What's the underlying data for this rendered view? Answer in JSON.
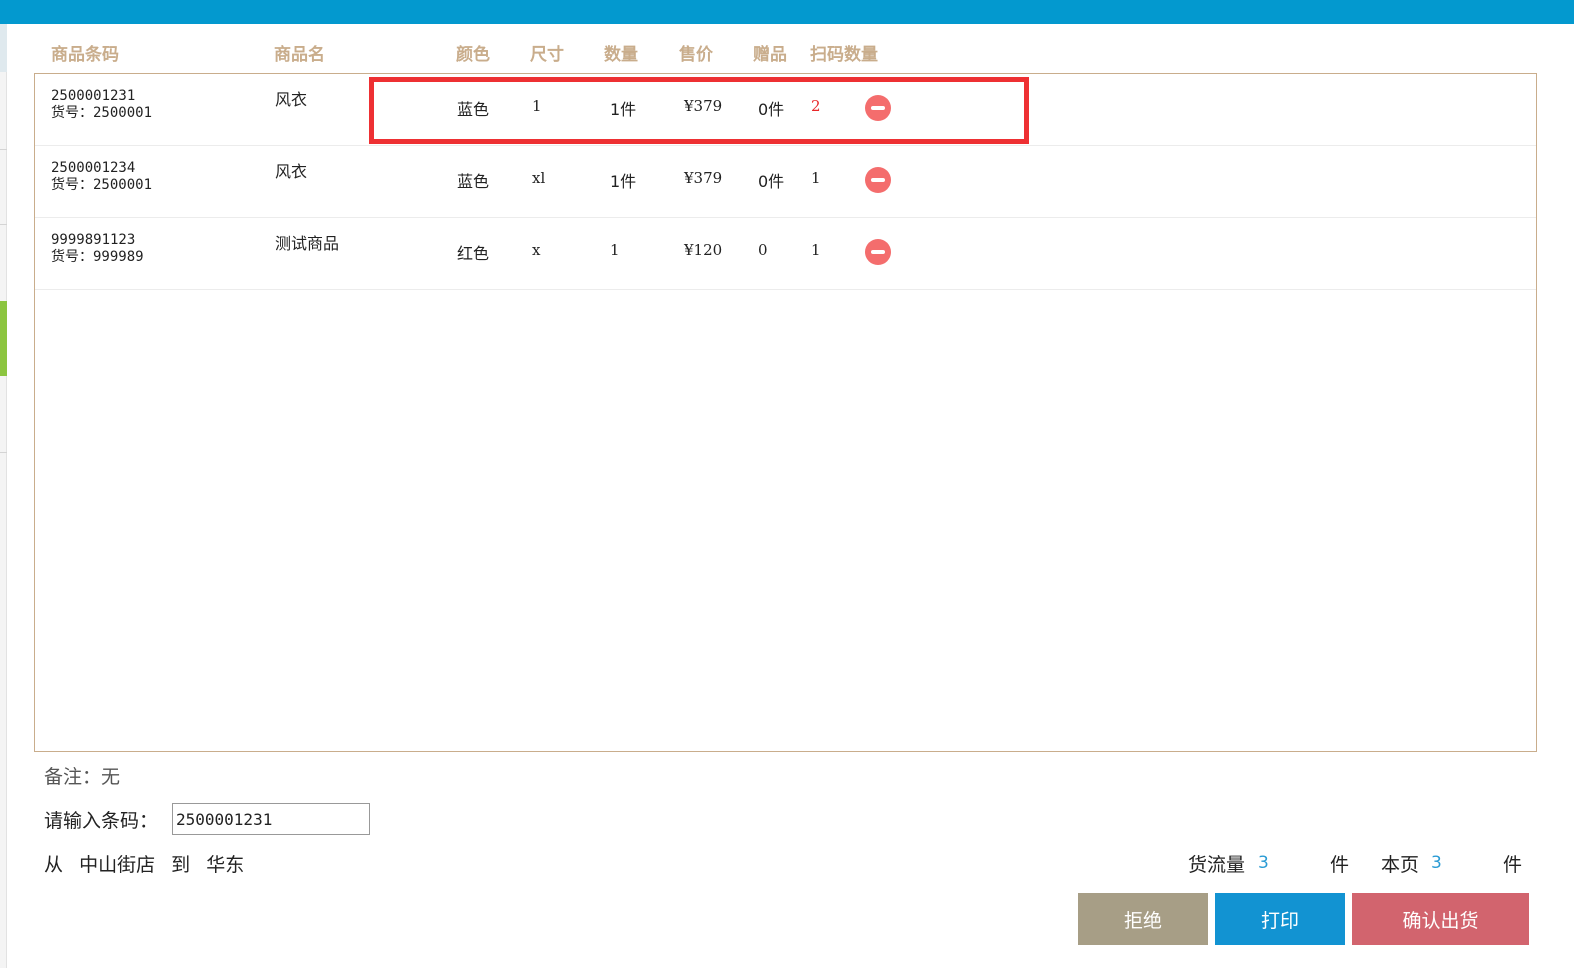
{
  "colors": {
    "topbar": "#0399cf",
    "header_text": "#c9ad8c",
    "highlight": "#ee3033",
    "scan_red": "#e8282a",
    "remove_icon": "#f46d6d",
    "stat_number": "#2a9bd4",
    "reject_button": "#a79e86",
    "print_button": "#1293d2",
    "confirm_button": "#d2646e"
  },
  "table": {
    "headers": {
      "barcode": "商品条码",
      "name": "商品名",
      "color": "颜色",
      "size": "尺寸",
      "qty": "数量",
      "price": "售价",
      "gift": "赠品",
      "scan_qty": "扫码数量"
    },
    "rows": [
      {
        "barcode": "2500001231",
        "sku": "货号：2500001",
        "name": "风衣",
        "color": "蓝色",
        "size": "1",
        "qty": "1件",
        "price": "¥379",
        "gift": "0件",
        "scan_qty": "2",
        "remove_icon": "minus-circle-icon"
      },
      {
        "barcode": "2500001234",
        "sku": "货号：2500001",
        "name": "风衣",
        "color": "蓝色",
        "size": "xl",
        "qty": "1件",
        "price": "¥379",
        "gift": "0件",
        "scan_qty": "1",
        "remove_icon": "minus-circle-icon"
      },
      {
        "barcode": "9999891123",
        "sku": "货号：999989",
        "name": "测试商品",
        "color": "红色",
        "size": "x",
        "qty": "1",
        "price": "¥120",
        "gift": "0",
        "scan_qty": "1",
        "remove_icon": "minus-circle-icon"
      }
    ]
  },
  "note": "备注：无",
  "barcode_input": {
    "label": "请输入条码：",
    "value": "2500001231"
  },
  "route": {
    "from_label": "从",
    "from": "中山街店",
    "to_label": "到",
    "to": "华东"
  },
  "stats": {
    "flow_label": "货流量",
    "flow_value": "3",
    "flow_unit": "件",
    "page_label": "本页",
    "page_value": "3",
    "page_unit": "件"
  },
  "buttons": {
    "reject": "拒绝",
    "print": "打印",
    "confirm": "确认出货"
  }
}
